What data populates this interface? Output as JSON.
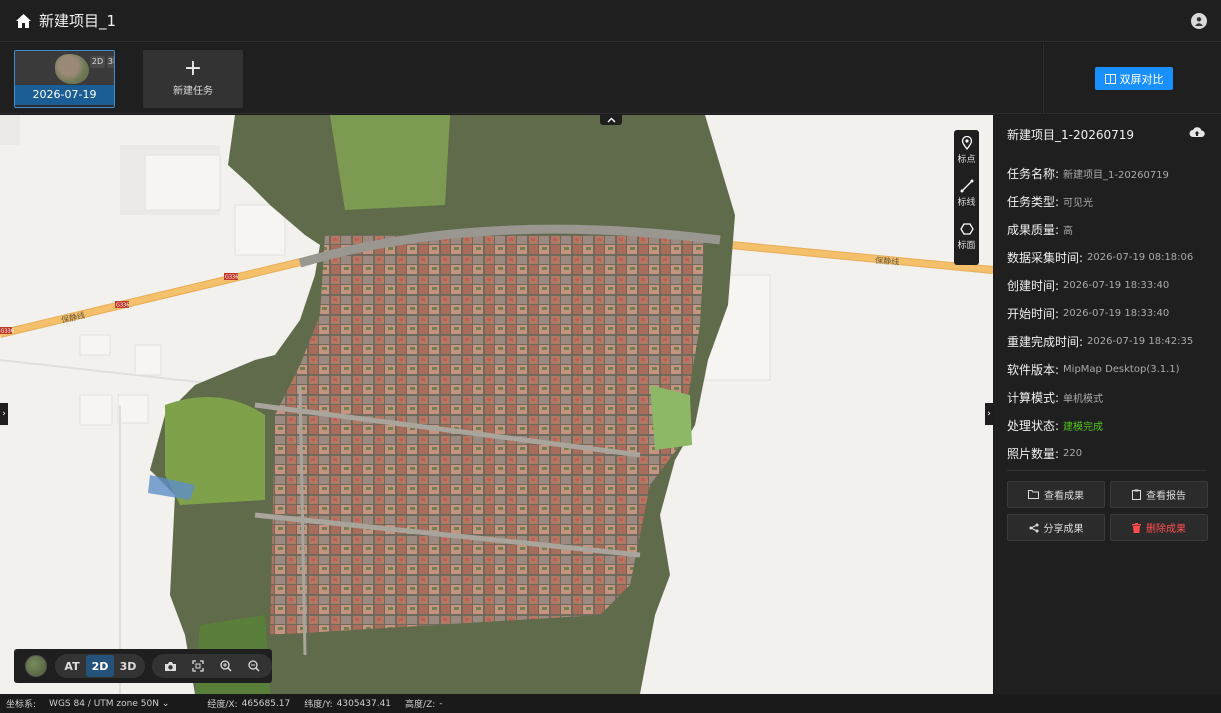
{
  "header": {
    "title": "新建项目_1",
    "home_icon": "home-icon",
    "user_icon": "user-icon"
  },
  "tasks": [
    {
      "date": "2026-07-19",
      "modes": [
        "2D",
        "3D"
      ],
      "selected": true
    }
  ],
  "new_task": {
    "label": "新建任务",
    "icon": "plus-icon"
  },
  "compare_button": {
    "label": "双屏对比",
    "icon": "split-screen-icon"
  },
  "map": {
    "road_labels": [
      "保静线",
      "保静线"
    ],
    "road_shields": [
      "G336",
      "G336",
      "G336"
    ],
    "draw_tools": [
      {
        "label": "标点",
        "icon": "map-pin-icon"
      },
      {
        "label": "标线",
        "icon": "polyline-icon"
      },
      {
        "label": "标面",
        "icon": "polygon-icon"
      }
    ],
    "view_modes": [
      {
        "label": "AT",
        "active": false
      },
      {
        "label": "2D",
        "active": true
      },
      {
        "label": "3D",
        "active": false
      }
    ],
    "toolbar_icons": [
      "camera-icon",
      "fit-extent-icon",
      "zoom-in-icon",
      "zoom-out-icon"
    ]
  },
  "status": {
    "crs_label": "坐标系:",
    "crs_value": "WGS 84 / UTM zone 50N",
    "lon_label": "经度/X:",
    "lon_value": "465685.17",
    "lat_label": "纬度/Y:",
    "lat_value": "4305437.41",
    "alt_label": "高度/Z:",
    "alt_value": "-"
  },
  "panel": {
    "title": "新建项目_1-20260719",
    "upload_icon": "cloud-upload-icon",
    "fields": [
      {
        "key": "任务名称:",
        "value": "新建项目_1-20260719"
      },
      {
        "key": "任务类型:",
        "value": "可见光"
      },
      {
        "key": "成果质量:",
        "value": "高"
      },
      {
        "key": "数据采集时间:",
        "value": "2026-07-19 08:18:06"
      },
      {
        "key": "创建时间:",
        "value": "2026-07-19 18:33:40"
      },
      {
        "key": "开始时间:",
        "value": "2026-07-19 18:33:40"
      },
      {
        "key": "重建完成时间:",
        "value": "2026-07-19 18:42:35"
      },
      {
        "key": "软件版本:",
        "value": "MipMap Desktop(3.1.1)"
      },
      {
        "key": "计算模式:",
        "value": "单机模式"
      },
      {
        "key": "处理状态:",
        "value": "建模完成",
        "status": "success"
      },
      {
        "key": "照片数量:",
        "value": "220"
      }
    ],
    "actions": [
      {
        "label": "查看成果",
        "icon": "folder-icon"
      },
      {
        "label": "查看报告",
        "icon": "clipboard-icon"
      },
      {
        "label": "分享成果",
        "icon": "share-icon"
      },
      {
        "label": "删除成果",
        "icon": "trash-icon",
        "danger": true
      }
    ]
  },
  "colors": {
    "accent": "#1890ff",
    "success": "#52c41a",
    "danger": "#ff4d4f",
    "road": "#f4c06b"
  }
}
